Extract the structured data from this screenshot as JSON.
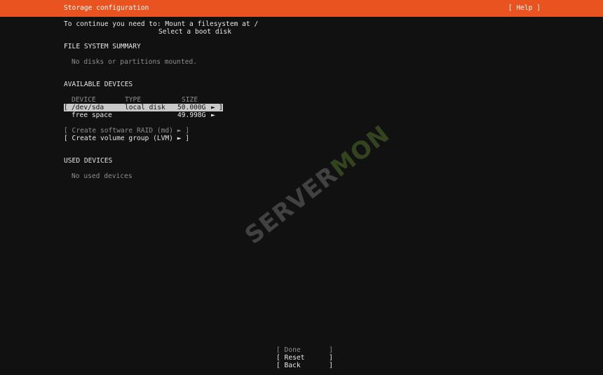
{
  "header": {
    "title": "Storage configuration",
    "help_label": "[ Help ]"
  },
  "intro": {
    "line1": "To continue you need to: Mount a filesystem at /",
    "line2": "Select a boot disk"
  },
  "fs_summary": {
    "heading": "FILE SYSTEM SUMMARY",
    "empty_text": "No disks or partitions mounted."
  },
  "available": {
    "heading": "AVAILABLE DEVICES",
    "columns": {
      "device": "DEVICE",
      "type": "TYPE",
      "size": "SIZE"
    },
    "rows": [
      {
        "open_bracket": "[",
        "device": "/dev/sda",
        "type": "local disk",
        "size": "50.000G",
        "arrow": "►",
        "close_bracket": "]"
      },
      {
        "device": "free space",
        "type": "",
        "size": "49.998G",
        "arrow": "►"
      }
    ],
    "actions": {
      "raid": "[ Create software RAID (md) ► ]",
      "lvm": "[ Create volume group (LVM) ► ]"
    }
  },
  "used": {
    "heading": "USED DEVICES",
    "empty_text": "No used devices"
  },
  "buttons": {
    "done": "[ Done       ]",
    "reset": "[ Reset      ]",
    "back": "[ Back       ]"
  },
  "watermark": {
    "part1": "SERVER",
    "part2": "MON"
  }
}
